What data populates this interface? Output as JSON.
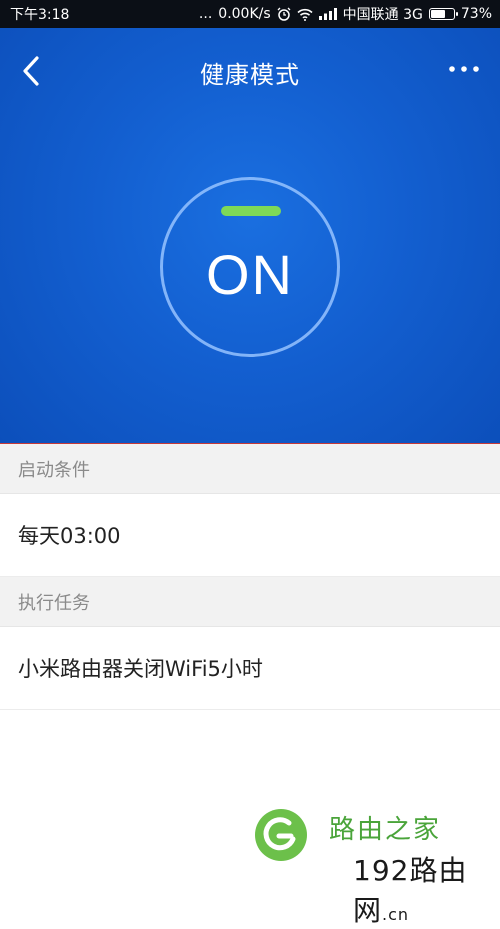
{
  "status_bar": {
    "time": "下午3:18",
    "dots": "...",
    "network_speed": "0.00K/s",
    "carrier": "中国联通 3G",
    "battery": "73%",
    "battery_level": 0.73
  },
  "header": {
    "title": "健康模式"
  },
  "toggle": {
    "state_label": "ON",
    "indicator_color": "#7ed957"
  },
  "sections": [
    {
      "header": "启动条件",
      "value": "每天03:00"
    },
    {
      "header": "执行任务",
      "value": "小米路由器关闭WiFi5小时"
    }
  ],
  "watermark": {
    "title": "路由之家",
    "subtitle": "192路由网",
    "suffix": ".cn"
  },
  "colors": {
    "hero_blue": "#135fd0",
    "accent_green": "#7ed957",
    "section_bg": "#f2f2f2"
  }
}
